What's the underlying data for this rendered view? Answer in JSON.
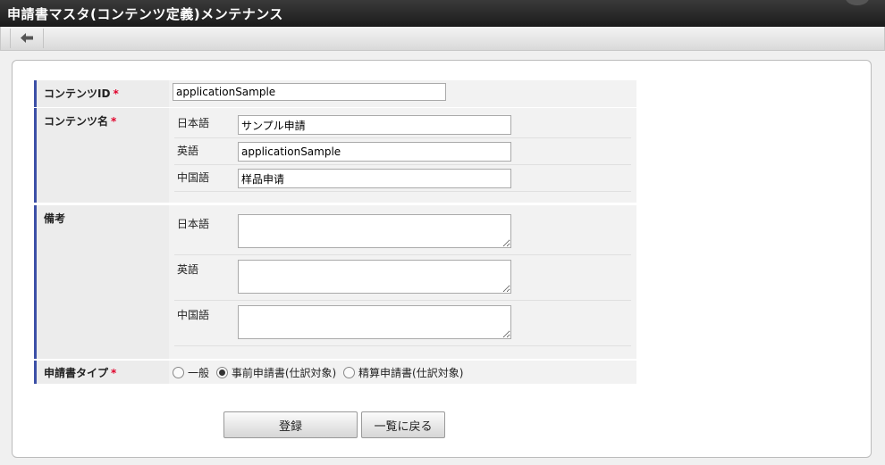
{
  "header": {
    "title": "申請書マスタ(コンテンツ定義)メンテナンス"
  },
  "toolbar": {
    "back_icon": "arrow-left-icon"
  },
  "form": {
    "required_mark": "*",
    "content_id": {
      "label": "コンテンツID",
      "value": "applicationSample"
    },
    "content_name": {
      "label": "コンテンツ名",
      "langs": [
        {
          "lang": "日本語",
          "value": "サンプル申請"
        },
        {
          "lang": "英語",
          "value": "applicationSample"
        },
        {
          "lang": "中国語",
          "value": "样品申请"
        }
      ]
    },
    "remarks": {
      "label": "備考",
      "langs": [
        {
          "lang": "日本語",
          "value": ""
        },
        {
          "lang": "英語",
          "value": ""
        },
        {
          "lang": "中国語",
          "value": ""
        }
      ]
    },
    "app_type": {
      "label": "申請書タイプ",
      "options": [
        "一般",
        "事前申請書(仕訳対象)",
        "精算申請書(仕訳対象)"
      ],
      "selected": "事前申請書(仕訳対象)"
    }
  },
  "buttons": {
    "register": "登録",
    "back_to_list": "一覧に戻る"
  },
  "colors": {
    "title_bar": "#2a2a2a",
    "label_accent": "#3b4fa6",
    "required": "#e0002a"
  }
}
